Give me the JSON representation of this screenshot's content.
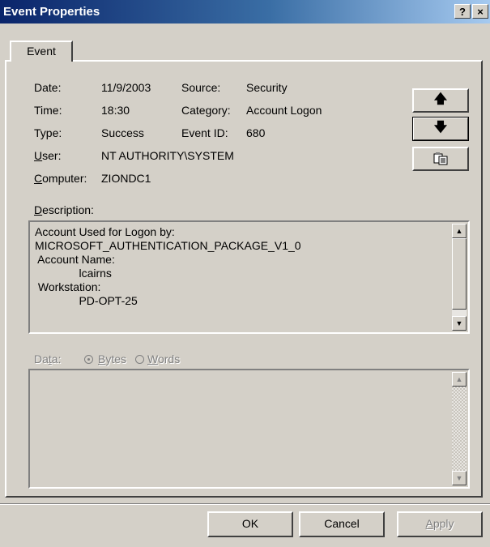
{
  "window": {
    "title": "Event Properties",
    "help_label": "?",
    "close_label": "×"
  },
  "tabs": [
    {
      "label": "Event"
    }
  ],
  "fields": {
    "date_label": "Date:",
    "date_value": "11/9/2003",
    "source_label": "Source:",
    "source_value": "Security",
    "time_label": "Time:",
    "time_value": "18:30",
    "category_label": "Category:",
    "category_value": "Account Logon",
    "type_label": "Type:",
    "type_value": "Success",
    "eventid_label": "Event ID:",
    "eventid_value": "680",
    "user_label_u": "U",
    "user_label_rest": "ser:",
    "user_value": "NT AUTHORITY\\SYSTEM",
    "computer_label_u": "C",
    "computer_label_rest": "omputer:",
    "computer_value": "ZIONDC1"
  },
  "description": {
    "label_u": "D",
    "label_rest": "escription:",
    "text": "Account Used for Logon by:\nMICROSOFT_AUTHENTICATION_PACKAGE_V1_0\n Account Name:\n              lcairns\n Workstation:\n              PD-OPT-25"
  },
  "data_section": {
    "label_a": "Da",
    "label_u": "t",
    "label_b": "a:",
    "bytes_u": "B",
    "bytes_rest": "ytes",
    "words_u": "W",
    "words_rest": "ords",
    "selected": "Bytes"
  },
  "nav": {
    "up_icon": "arrow-up-icon",
    "down_icon": "arrow-down-icon",
    "copy_icon": "copy-icon"
  },
  "buttons": {
    "ok": "OK",
    "cancel": "Cancel",
    "apply_u": "A",
    "apply_rest": "pply"
  }
}
